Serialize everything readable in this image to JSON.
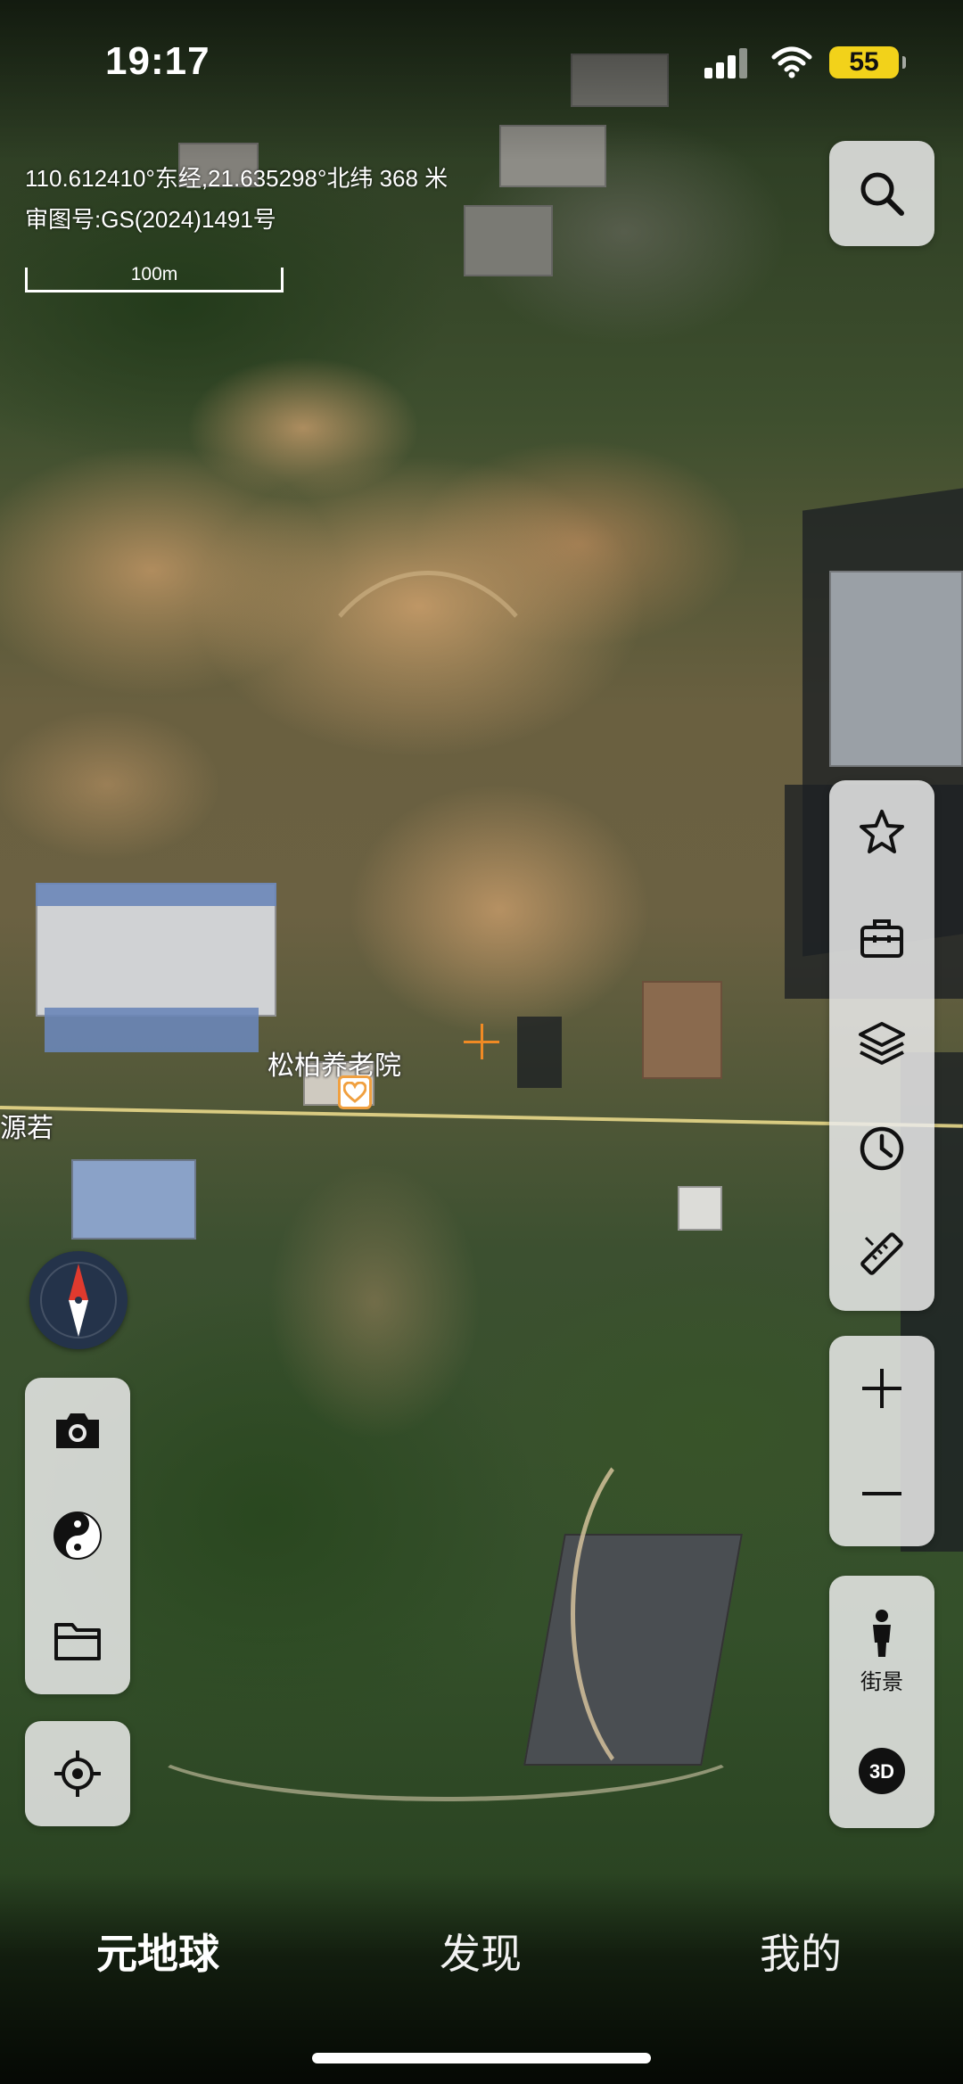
{
  "status_bar": {
    "time": "19:17",
    "battery_level": "55"
  },
  "map": {
    "coordinates": "110.612410°东经,21.635298°北纬 368 米",
    "approval_number": "审图号:GS(2024)1491号",
    "scale_label": "100m",
    "poi_label": "松柏养老院",
    "road_label": "源若",
    "crosshair_color": "#f08a24"
  },
  "right_toolbar": {
    "search": "search-icon",
    "favorites": "star-icon",
    "toolbox": "toolbox-icon",
    "layers": "layers-icon",
    "history": "clock-icon",
    "measure": "ruler-icon",
    "zoom_in": "plus-icon",
    "zoom_out": "minus-icon",
    "street_view_label": "街景",
    "mode_3d_label": "3D"
  },
  "left_toolbar": {
    "camera": "camera-icon",
    "compass_tool": "yin-yang-icon",
    "folder": "folder-icon",
    "locate": "locate-icon"
  },
  "tabs": [
    {
      "label": "元地球",
      "active": true
    },
    {
      "label": "发现",
      "active": false
    },
    {
      "label": "我的",
      "active": false
    }
  ]
}
